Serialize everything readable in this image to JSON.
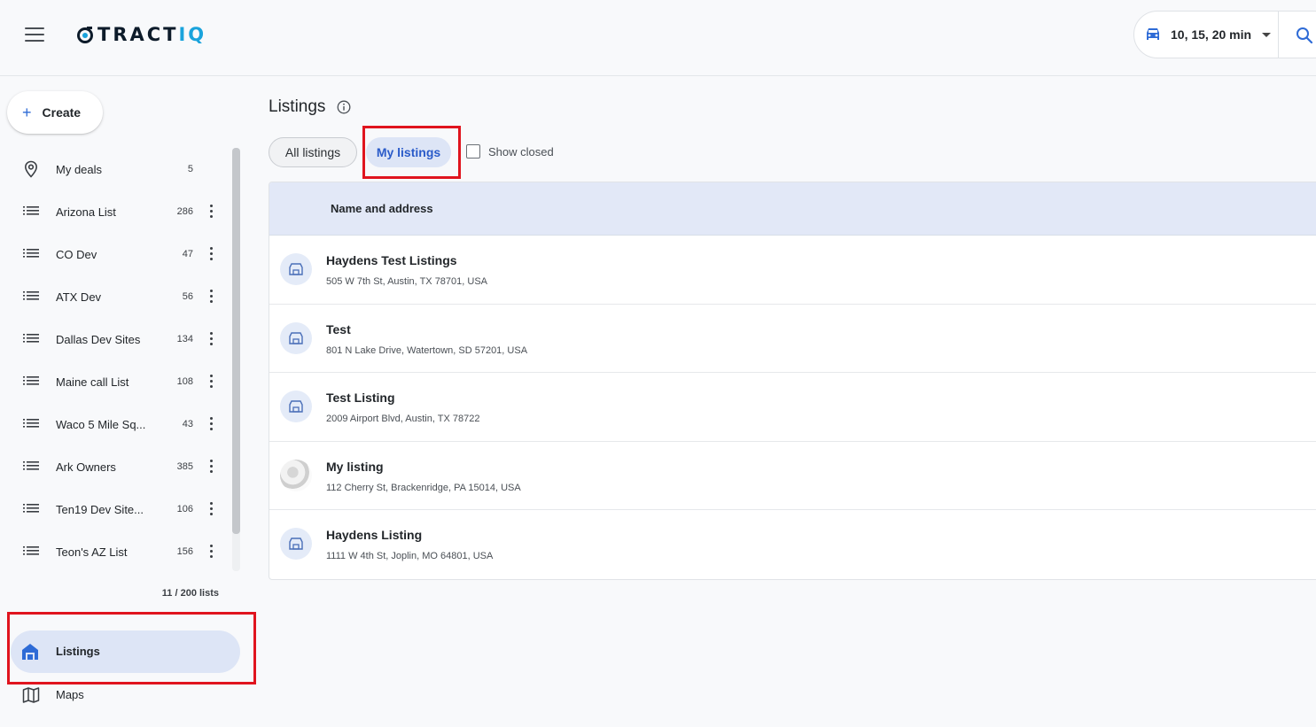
{
  "header": {
    "logo_text": "TRACT",
    "logo_accent": "IQ",
    "drive_time": "10, 15, 20 min"
  },
  "sidebar": {
    "create_label": "Create",
    "items": [
      {
        "label": "My deals",
        "count": "5",
        "icon": "location-pin-icon"
      },
      {
        "label": "Arizona List",
        "count": "286",
        "icon": "list-icon"
      },
      {
        "label": "CO Dev",
        "count": "47",
        "icon": "list-icon"
      },
      {
        "label": "ATX Dev",
        "count": "56",
        "icon": "list-icon"
      },
      {
        "label": "Dallas Dev Sites",
        "count": "134",
        "icon": "list-icon"
      },
      {
        "label": "Maine call List",
        "count": "108",
        "icon": "list-icon"
      },
      {
        "label": "Waco 5 Mile Sq...",
        "count": "43",
        "icon": "list-icon"
      },
      {
        "label": "Ark Owners",
        "count": "385",
        "icon": "list-icon"
      },
      {
        "label": "Ten19 Dev Site...",
        "count": "106",
        "icon": "list-icon"
      },
      {
        "label": "Teon's AZ List",
        "count": "156",
        "icon": "list-icon"
      }
    ],
    "list_counter": "11 / 200 lists",
    "nav_listings": "Listings",
    "nav_maps": "Maps"
  },
  "main": {
    "title": "Listings",
    "tabs": [
      {
        "label": "All listings",
        "active": false
      },
      {
        "label": "My listings",
        "active": true
      }
    ],
    "show_closed_label": "Show closed",
    "show_closed_checked": false,
    "table": {
      "column": "Name and address",
      "rows": [
        {
          "name": "Haydens Test Listings",
          "address": "505 W 7th St, Austin, TX 78701, USA",
          "thumb": "storefront-icon"
        },
        {
          "name": "Test",
          "address": "801 N Lake Drive, Watertown, SD 57201, USA",
          "thumb": "storefront-icon"
        },
        {
          "name": "Test Listing",
          "address": "2009 Airport Blvd, Austin, TX 78722",
          "thumb": "storefront-icon"
        },
        {
          "name": "My listing",
          "address": "112 Cherry St, Brackenridge, PA 15014, USA",
          "thumb": "photo"
        },
        {
          "name": "Haydens Listing",
          "address": "1111 W 4th St, Joplin, MO 64801, USA",
          "thumb": "storefront-icon"
        }
      ]
    }
  },
  "colors": {
    "accent": "#2e6bd6",
    "active_bg": "#dde5f6",
    "highlight_box": "#e0141e",
    "logo_accent": "#1aa3dc"
  }
}
